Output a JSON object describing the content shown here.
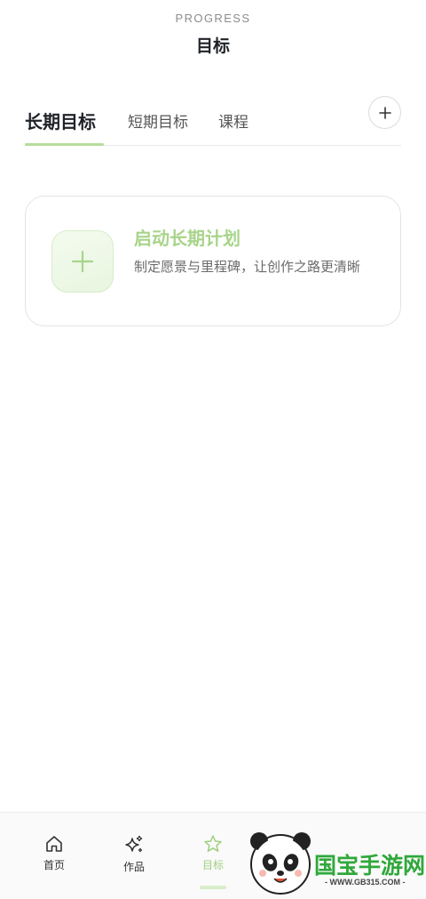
{
  "header": {
    "eyebrow": "PROGRESS",
    "title": "目标"
  },
  "tabs": [
    {
      "label": "长期目标",
      "active": true
    },
    {
      "label": "短期目标",
      "active": false
    },
    {
      "label": "课程",
      "active": false
    }
  ],
  "add_button_icon": "plus-icon",
  "card": {
    "icon": "plus-icon",
    "title": "启动长期计划",
    "description": "制定愿景与里程碑，让创作之路更清晰"
  },
  "bottom_nav": [
    {
      "label": "首页",
      "icon": "home-icon",
      "active": false
    },
    {
      "label": "作品",
      "icon": "sparkle-icon",
      "active": false
    },
    {
      "label": "目标",
      "icon": "star-icon",
      "active": true
    }
  ],
  "watermark": {
    "brand": "国宝手游网",
    "url": "- WWW.GB315.COM -"
  },
  "colors": {
    "accent": "#a8d48a",
    "accent_light": "#e8f5df",
    "text_primary": "#1f2328",
    "text_secondary": "#6b6b6b"
  }
}
